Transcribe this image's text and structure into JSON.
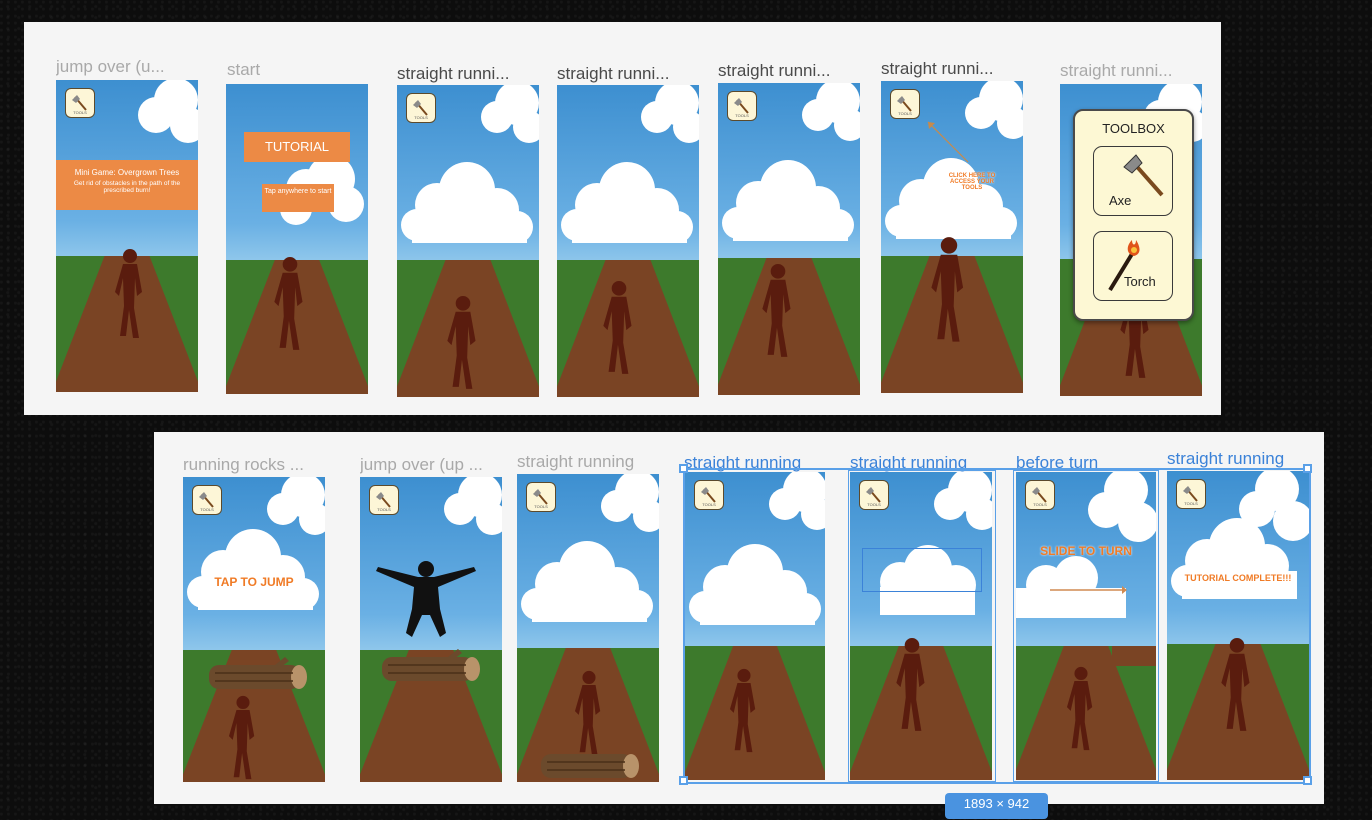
{
  "top_row": {
    "frames": [
      {
        "label": "jump over (u...",
        "label_style": "muted"
      },
      {
        "label": "start",
        "label_style": "muted"
      },
      {
        "label": "straight runni...",
        "label_style": "dark"
      },
      {
        "label": "straight runni...",
        "label_style": "dark"
      },
      {
        "label": "straight runni...",
        "label_style": "dark"
      },
      {
        "label": "straight runni...",
        "label_style": "dark"
      },
      {
        "label": "straight runni...",
        "label_style": "muted"
      }
    ]
  },
  "bottom_row": {
    "frames": [
      {
        "label": "running rocks ...",
        "label_style": "muted"
      },
      {
        "label": "jump over (up ...",
        "label_style": "muted"
      },
      {
        "label": "straight running",
        "label_style": "muted"
      },
      {
        "label": "straight running",
        "label_style": "selected"
      },
      {
        "label": "straight running",
        "label_style": "selected"
      },
      {
        "label": "before turn",
        "label_style": "selected"
      },
      {
        "label": "straight running",
        "label_style": "selected"
      }
    ]
  },
  "game_text": {
    "tools_button": "TOOLS",
    "mini_game_title": "Mini Game: Overgrown Trees",
    "mini_game_desc": "Get rid of obstacles in the path of the prescribed burn!",
    "tutorial_button": "TUTORIAL",
    "tap_anywhere": "Tap anywhere to start",
    "click_tools_hint": "CLICK HERE TO ACCESS YOUR TOOLS",
    "tap_to_jump": "TAP TO JUMP",
    "slide_to_turn": "SLIDE TO TURN",
    "tutorial_complete": "TUTORIAL COMPLETE!!!"
  },
  "toolbox": {
    "title": "TOOLBOX",
    "items": [
      {
        "name": "Axe",
        "icon": "axe-icon"
      },
      {
        "name": "Torch",
        "icon": "torch-icon"
      }
    ]
  },
  "selection": {
    "size_label": "1893 × 942"
  },
  "colors": {
    "selection": "#5aa0e8",
    "banner": "#ec8a45",
    "ground": "#3d7a2c",
    "path": "#7a4424",
    "runner": "#5a1c0e"
  }
}
